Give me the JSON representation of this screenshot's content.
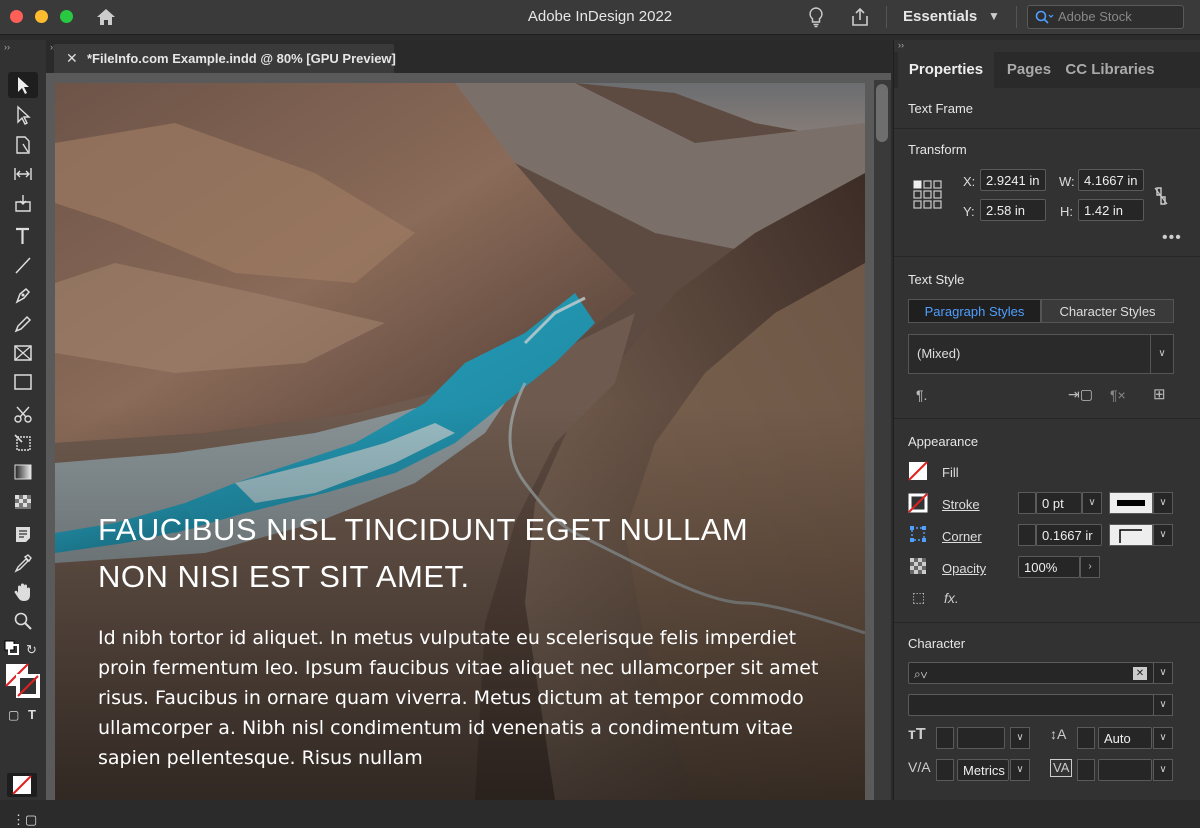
{
  "app": {
    "title": "Adobe InDesign 2022",
    "workspace": "Essentials",
    "stock_placeholder": "Adobe Stock"
  },
  "document": {
    "tab_label": "*FileInfo.com Example.indd @ 80% [GPU Preview]",
    "close_glyph": "✕"
  },
  "page": {
    "headline": "FAUCIBUS NISL TINCIDUNT EGET NULLAM NON NISI EST SIT AMET.",
    "body": "Id nibh tortor id aliquet. In metus vulputate eu scelerisque felis imperdiet proin fermentum leo. Ipsum faucibus vitae aliquet nec ullamcorper sit amet risus. Faucibus in ornare quam viverra. Metus dictum at tempor commodo ullamcorper a. Nibh nisl condimentum id venenatis a condimentum vitae sapien pellentesque. Risus nullam"
  },
  "panel": {
    "tabs": [
      "Properties",
      "Pages",
      "CC Libraries"
    ],
    "text_frame": "Text Frame",
    "transform": {
      "title": "Transform",
      "x_label": "X:",
      "x": "2.9241 in",
      "y_label": "Y:",
      "y": "2.58 in",
      "w_label": "W:",
      "w": "4.1667 in",
      "h_label": "H:",
      "h": "1.42 in"
    },
    "text_style": {
      "title": "Text Style",
      "paragraph_tab": "Paragraph Styles",
      "character_tab": "Character Styles",
      "selected": "(Mixed)"
    },
    "appearance": {
      "title": "Appearance",
      "fill": "Fill",
      "stroke": "Stroke",
      "stroke_weight": "0 pt",
      "corner": "Corner",
      "corner_size": "0.1667 ir",
      "opacity": "Opacity",
      "opacity_value": "100%",
      "fx": "fx."
    },
    "character": {
      "title": "Character",
      "leading": "Auto",
      "kerning": "Metrics"
    }
  },
  "colors": {
    "accent": "#4f9fff",
    "text_on_page": "#ffffff",
    "panel_bg": "#323232"
  }
}
